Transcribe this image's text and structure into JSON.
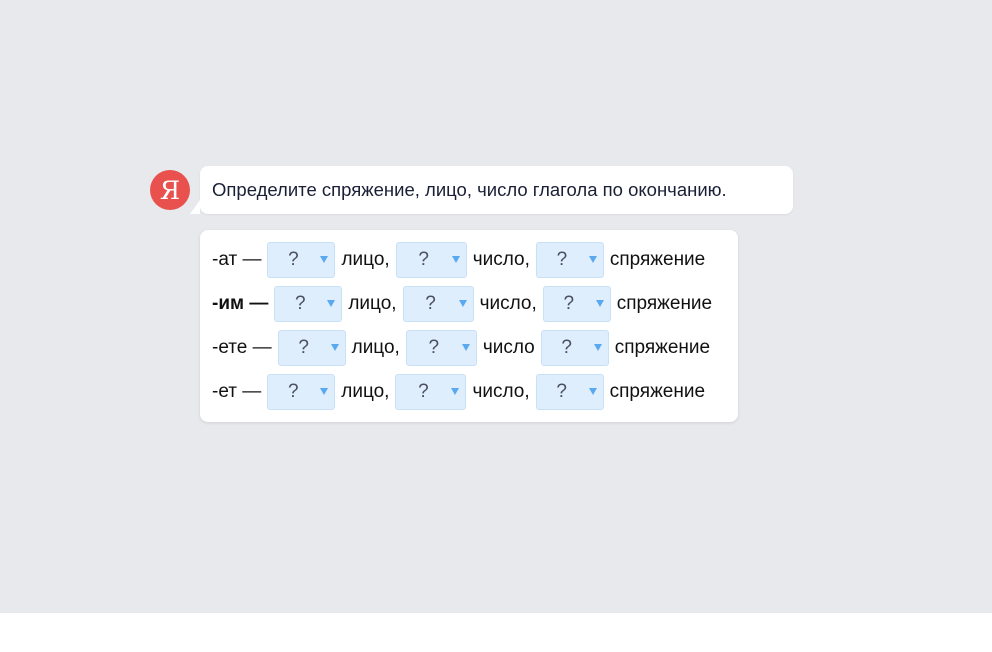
{
  "avatar": {
    "letter": "Я"
  },
  "prompt": "Определите спряжение, лицо, число глагола по окончанию.",
  "colors": {
    "background": "#e8e9ed",
    "avatar": "#e8514d",
    "dropdown_bg": "#deeefc",
    "dropdown_arrow": "#5aa9f0"
  },
  "rows": [
    {
      "ending": "-ат —",
      "person_value": "?",
      "person_label": "лицо,",
      "number_value": "?",
      "number_label": "число,",
      "conj_value": "?",
      "conj_label": "спряжение"
    },
    {
      "ending": "-им —",
      "person_value": "?",
      "person_label": "лицо,",
      "number_value": "?",
      "number_label": "число,",
      "conj_value": "?",
      "conj_label": "спряжение"
    },
    {
      "ending": "-ете —",
      "person_value": "?",
      "person_label": "лицо,",
      "number_value": "?",
      "number_label": "число",
      "conj_value": "?",
      "conj_label": "спряжение"
    },
    {
      "ending": "-ет —",
      "person_value": "?",
      "person_label": "лицо,",
      "number_value": "?",
      "number_label": "число,",
      "conj_value": "?",
      "conj_label": "спряжение"
    }
  ]
}
